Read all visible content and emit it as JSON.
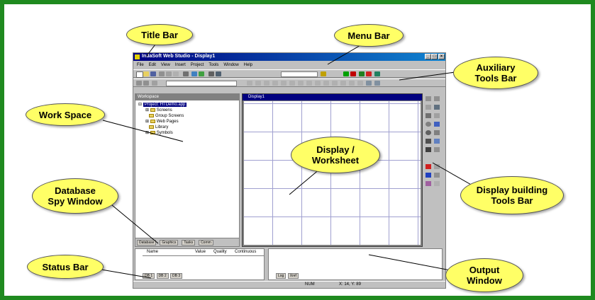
{
  "app": {
    "title": "IndaSoft Web Studio - Display1",
    "window_buttons": [
      "_",
      "□",
      "×"
    ],
    "menu": [
      "File",
      "Edit",
      "View",
      "Insert",
      "Project",
      "Tools",
      "Window",
      "Help"
    ],
    "workspace_title": "Workspace",
    "tree": {
      "project": "Project: HTDemo.app",
      "items": [
        "Screens",
        "Group Screens",
        "Web Pages",
        "Library",
        "Symbols"
      ]
    },
    "workspace_tabs": [
      "Database",
      "Graphics",
      "Tasks",
      "Comm"
    ],
    "display_title": "Display1",
    "spy_columns": [
      "Name",
      "Value",
      "Quality",
      "Continuous"
    ],
    "spy_tabs": [
      "DB 1",
      "DB 2",
      "DB 3"
    ],
    "output_tabs": [
      "Log",
      "Xref"
    ],
    "status": {
      "mode": "NUM",
      "coords": "X: 14, Y: 89"
    }
  },
  "callouts": {
    "title_bar": "Title Bar",
    "menu_bar": "Menu Bar",
    "auxiliary": "Auxiliary\nTools Bar",
    "workspace": "Work Space",
    "display": "Display /\nWorksheet",
    "database_spy": "Database\nSpy Window",
    "display_tools": "Display building\nTools Bar",
    "status_bar": "Status Bar",
    "output": "Output\nWindow"
  },
  "colors": {
    "border": "#1f8a1f",
    "callout_fill": "#ffff66",
    "title_bar": "#000080"
  }
}
